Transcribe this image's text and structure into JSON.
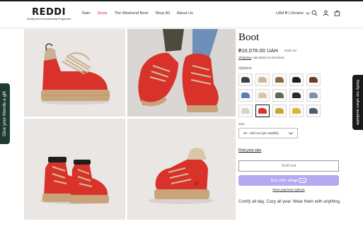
{
  "header": {
    "logo": "REDDI",
    "logo_tagline": "Socially and Environmentally Progressive",
    "nav": [
      "Rain",
      "Snow",
      "The Weekend Boot",
      "Shop All",
      "About Us"
    ],
    "active_nav": "Snow",
    "locale": "UAH ₴ | Ukraine"
  },
  "side_tab": {
    "label": "Give your friends a gift"
  },
  "notify_tab": {
    "label": "Notify me when available"
  },
  "product": {
    "title": "Boot",
    "price": "₴10,078.00 UAH",
    "badge": "Sold out",
    "shipping_link": "Shipping",
    "shipping_rest": " calculated at checkout.",
    "options_label": "Options",
    "size_label": "Size",
    "size_value": "36 - sold out (join waitlist)",
    "find_size": "Find your size",
    "sold_out_button": "Sold out",
    "shop_pay_prefix": "Buy with",
    "shop_pay_brand": "shop",
    "shop_pay_suffix": "Pay",
    "more_payment": "More payment options",
    "description": "Comfy all day. Cozy all year. Wear them with anything."
  },
  "swatch_colors": [
    "#3a3f4a",
    "#cbb79a",
    "#8a6b3e",
    "#1e1e1e",
    "#6e3a2a",
    "#5a7fb0",
    "#d8c7a8",
    "#5b6a52",
    "#2a2a2a",
    "#7f8fa8",
    "#d9d3c7",
    "#d8322b",
    "#c9a43a",
    "#d9b736",
    "#4d5d74"
  ],
  "selected_swatch": 11,
  "colors": {
    "accent_red": "#d7263d",
    "boot_red": "#d8322b",
    "sole": "#c9a47a",
    "shop_pay": "#b7a8f2",
    "side_tab": "#1f3a30"
  }
}
